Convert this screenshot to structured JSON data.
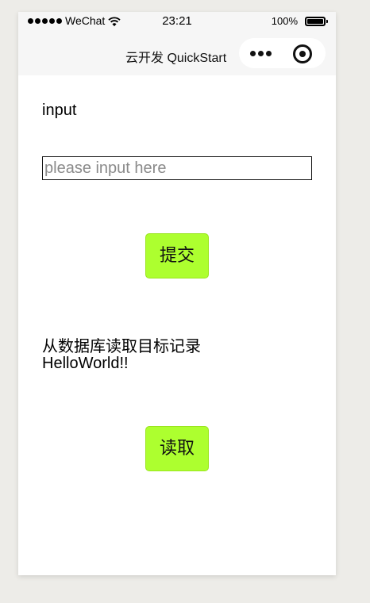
{
  "status_bar": {
    "carrier": "WeChat",
    "time": "23:21",
    "battery": "100%",
    "battery_level": 1.0
  },
  "nav": {
    "title": "云开发 QuickStart"
  },
  "form": {
    "label": "input",
    "input_placeholder": "please input here",
    "input_value": "",
    "submit_label": "提交"
  },
  "record": {
    "caption": "从数据库读取目标记录",
    "value": "HelloWorld!!",
    "read_label": "读取"
  },
  "colors": {
    "button": "#adff2f",
    "background": "#edece8"
  },
  "icons": {
    "more": "more-dots-icon",
    "close": "target-circle-icon",
    "wifi": "wifi-icon",
    "battery": "battery-icon",
    "signal": "signal-dots-icon"
  }
}
